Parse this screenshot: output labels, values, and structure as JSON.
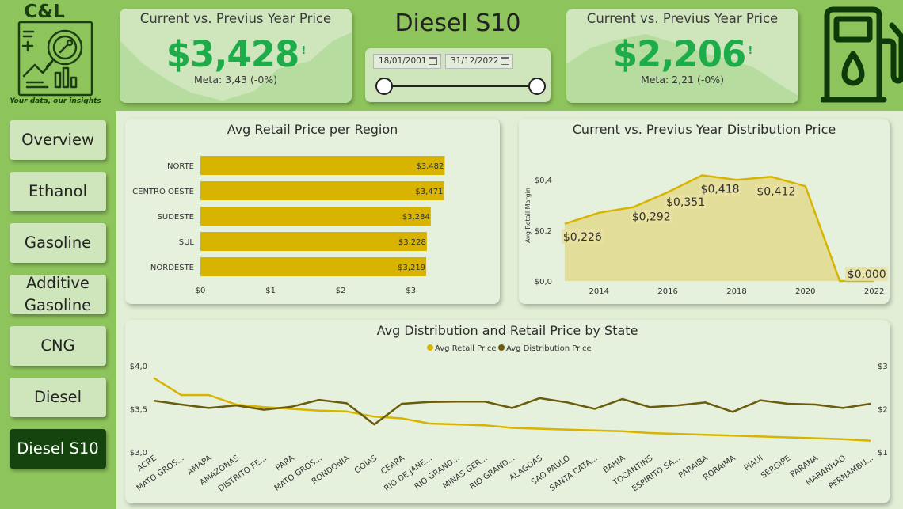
{
  "logo": {
    "title": "C&L",
    "tagline": "Your data, our insights"
  },
  "kpis": [
    {
      "title": "Current vs. Previus Year Price",
      "value": "$3,428",
      "indicator": "!",
      "meta": "Meta: 3,43 (-0%)"
    },
    {
      "title": "Current vs. Previus Year Price",
      "value": "$2,206",
      "indicator": "!",
      "meta": "Meta: 2,21 (-0%)"
    }
  ],
  "product_title": "Diesel S10",
  "date_range": {
    "start": "18/01/2001",
    "end": "31/12/2022"
  },
  "nav": [
    {
      "label": "Overview",
      "active": false
    },
    {
      "label": "Ethanol",
      "active": false
    },
    {
      "label": "Gasoline",
      "active": false
    },
    {
      "label": "Additive Gasoline",
      "active": false
    },
    {
      "label": "CNG",
      "active": false
    },
    {
      "label": "Diesel",
      "active": false
    },
    {
      "label": "Diesel S10",
      "active": true
    }
  ],
  "colors": {
    "retail": "#d8b400",
    "distribution": "#6b5b0c",
    "kpi_value": "#1eac4a",
    "active_nav": "#16440f",
    "area_fill": "#e2d98c"
  },
  "chart_data": [
    {
      "type": "bar",
      "title": "Avg Retail Price per Region",
      "categories": [
        "NORTE",
        "CENTRO OESTE",
        "SUDESTE",
        "SUL",
        "NORDESTE"
      ],
      "values": [
        3.482,
        3.471,
        3.284,
        3.228,
        3.219
      ],
      "data_labels": [
        "$3,482",
        "$3,471",
        "$3,284",
        "$3,228",
        "$3,219"
      ],
      "x_ticks": [
        "$0",
        "$1",
        "$2",
        "$3"
      ],
      "xlim": [
        0,
        3.5
      ],
      "orientation": "horizontal",
      "color": "#d8b400"
    },
    {
      "type": "area",
      "title": "Current vs. Previus Year Distribution Price",
      "ylabel": "Avg Retail Margin",
      "x": [
        2013,
        2014,
        2015,
        2016,
        2017,
        2018,
        2019,
        2020,
        2021,
        2022
      ],
      "values": [
        0.226,
        0.27,
        0.292,
        0.351,
        0.418,
        0.4,
        0.412,
        0.375,
        0.0,
        0.0
      ],
      "data_labels": [
        {
          "index": 0,
          "text": "$0,226"
        },
        {
          "index": 2,
          "text": "$0,292"
        },
        {
          "index": 3,
          "text": "$0,351"
        },
        {
          "index": 4,
          "text": "$0,418"
        },
        {
          "index": 6,
          "text": "$0,412"
        },
        {
          "index": 9,
          "text": "$0,000"
        }
      ],
      "x_ticks": [
        "2014",
        "2016",
        "2018",
        "2020",
        "2022"
      ],
      "y_ticks": [
        "$0,0",
        "$0,2",
        "$0,4"
      ],
      "xlim": [
        2012.75,
        2022.1
      ],
      "ylim": [
        0,
        0.46
      ],
      "color": "#d8b400",
      "fill": "#e2d98c"
    },
    {
      "type": "line",
      "title": "Avg Distribution and Retail Price by State",
      "categories": [
        "ACRE",
        "MATO GROS...",
        "AMAPA",
        "AMAZONAS",
        "DISTRITO FE...",
        "PARA",
        "MATO GROS...",
        "RONDONIA",
        "GOIAS",
        "CEARA",
        "RIO DE JANE...",
        "RIO GRAND...",
        "MINAS GER...",
        "RIO GRAND...",
        "ALAGOAS",
        "SAO PAULO",
        "SANTA CATA...",
        "BAHIA",
        "TOCANTINS",
        "ESPIRITO SA...",
        "PARAIBA",
        "RORAIMA",
        "PIAUI",
        "SERGIPE",
        "PARANA",
        "MARANHAO",
        "PERNAMBU..."
      ],
      "series": [
        {
          "name": "Avg Retail Price",
          "axis": "left",
          "color": "#d8b400",
          "values": [
            3.86,
            3.66,
            3.66,
            3.55,
            3.52,
            3.5,
            3.48,
            3.47,
            3.41,
            3.39,
            3.33,
            3.32,
            3.31,
            3.28,
            3.27,
            3.26,
            3.25,
            3.24,
            3.22,
            3.21,
            3.2,
            3.19,
            3.18,
            3.17,
            3.16,
            3.15,
            3.13
          ]
        },
        {
          "name": "Avg Distribution Price",
          "axis": "right",
          "color": "#6b5b0c",
          "values": [
            2.19,
            2.1,
            2.02,
            2.08,
            1.98,
            2.05,
            2.21,
            2.13,
            1.64,
            2.12,
            2.16,
            2.17,
            2.17,
            2.02,
            2.25,
            2.15,
            2.0,
            2.23,
            2.04,
            2.08,
            2.15,
            1.93,
            2.2,
            2.12,
            2.1,
            2.02,
            2.12
          ]
        }
      ],
      "y_left_ticks": [
        "$3,0",
        "$3,5",
        "$4,0"
      ],
      "y_left_lim": [
        3.0,
        4.0
      ],
      "y_right_ticks": [
        "$1",
        "$2",
        "$3"
      ],
      "y_right_lim": [
        1,
        3
      ],
      "legend_position": "top-center"
    }
  ]
}
